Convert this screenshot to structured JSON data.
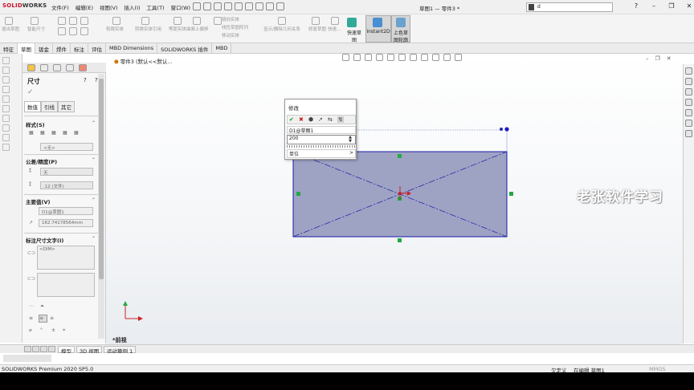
{
  "app": {
    "logo_main": "SOLID",
    "logo_sub": "WORKS",
    "title": "草图1 — 零件3 *",
    "search_value": "d",
    "menu": [
      "文件(F)",
      "编辑(E)",
      "视图(V)",
      "插入(I)",
      "工具(T)",
      "窗口(W)"
    ],
    "window_buttons": [
      "?",
      "–",
      "❐",
      "✕"
    ]
  },
  "toolbar": {
    "faint_items": [
      "退出草图",
      "智能尺寸",
      "剪裁实体",
      "转换实体引用",
      "等距实体",
      "曲面上偏移",
      "镜向实体",
      "线性草图阵列",
      "移动实体",
      "显示/删除几何关系",
      "修复草图",
      "快速..."
    ],
    "active_labels": [
      "快速草图",
      "Instant2D",
      "上色草图轮廓"
    ]
  },
  "tabs": [
    "特征",
    "草图",
    "钣金",
    "焊件",
    "标注",
    "评估",
    "MBD Dimensions",
    "SOLIDWORKS 插件",
    "MBD"
  ],
  "active_tab": "草图",
  "property_manager": {
    "title": "尺寸",
    "help": "?",
    "check": "✓",
    "subtabs": [
      "数值",
      "引线",
      "其它"
    ],
    "style_section": "样式(S)",
    "style_value": "<无>",
    "tolerance_section": "公差/精度(P)",
    "tolerance_type": "无",
    "precision": ".12 (文件)",
    "primary_section": "主要值(V)",
    "primary_name": "D1@草图1",
    "primary_value": "162.74178564mm",
    "dimtext_section": "标注尺寸文字(I)",
    "dimtext_value": "<DIM>"
  },
  "viewport": {
    "tree_item": "零件3 (默认<<默认...",
    "view_label": "*前视",
    "watermark": "老张软件学习"
  },
  "modify_dialog": {
    "title": "修改",
    "icons": [
      "✔",
      "✖",
      "⬢",
      "↗",
      "⇆",
      "↯"
    ],
    "name": "D1@草图1",
    "value": "200",
    "unit_label": "单位",
    "unit_arrow": ">"
  },
  "bottom_tabs": [
    "模型",
    "3D 视图",
    "运动算例 1"
  ],
  "active_bottom_tab": "模型",
  "status": {
    "app_version": "SOLIDWORKS Premium 2020 SP5.0",
    "state": "欠定义",
    "editing": "在编辑 草图1",
    "units": "MMGS"
  },
  "colors": {
    "rect_fill": "#9ea3c4",
    "rect_stroke": "#1a1aa8",
    "handle": "#22aa44",
    "origin": "#cc2222",
    "logo": "#c8102e"
  }
}
